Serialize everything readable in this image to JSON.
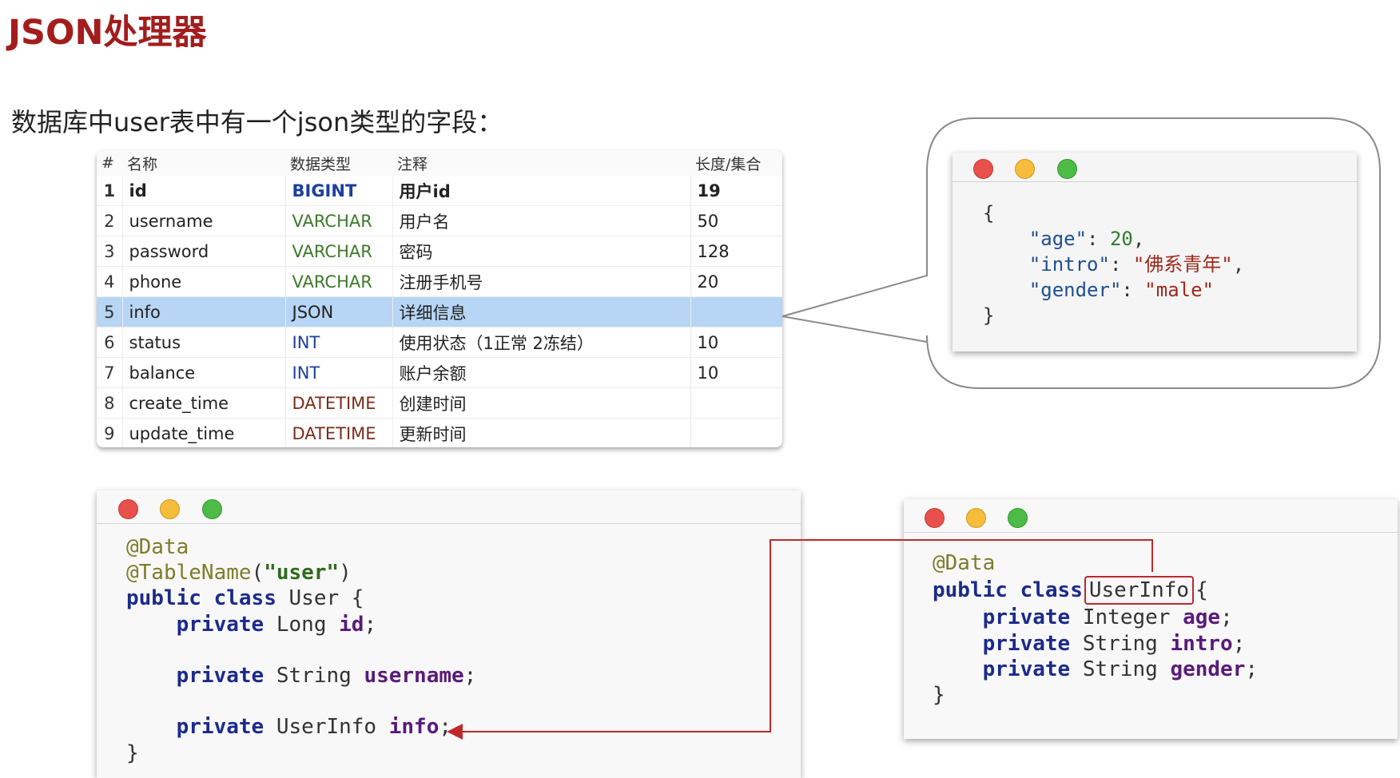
{
  "title": "JSON处理器",
  "subtitle": "数据库中user表中有一个json类型的字段：",
  "table": {
    "headers": [
      "#",
      "名称",
      "数据类型",
      "注释",
      "长度/集合"
    ],
    "rows": [
      {
        "num": "1",
        "name": "id",
        "type": "BIGINT",
        "comment": "用户id",
        "length": "19"
      },
      {
        "num": "2",
        "name": "username",
        "type": "VARCHAR",
        "comment": "用户名",
        "length": "50"
      },
      {
        "num": "3",
        "name": "password",
        "type": "VARCHAR",
        "comment": "密码",
        "length": "128"
      },
      {
        "num": "4",
        "name": "phone",
        "type": "VARCHAR",
        "comment": "注册手机号",
        "length": "20"
      },
      {
        "num": "5",
        "name": "info",
        "type": "JSON",
        "comment": "详细信息",
        "length": ""
      },
      {
        "num": "6",
        "name": "status",
        "type": "INT",
        "comment": "使用状态（1正常 2冻结）",
        "length": "10"
      },
      {
        "num": "7",
        "name": "balance",
        "type": "INT",
        "comment": "账户余额",
        "length": "10"
      },
      {
        "num": "8",
        "name": "create_time",
        "type": "DATETIME",
        "comment": "创建时间",
        "length": ""
      },
      {
        "num": "9",
        "name": "update_time",
        "type": "DATETIME",
        "comment": "更新时间",
        "length": ""
      }
    ]
  },
  "json_window": {
    "open": "{",
    "close": "}",
    "lines": [
      {
        "key": "\"age\"",
        "sep": ": ",
        "value": "20",
        "end": ","
      },
      {
        "key": "\"intro\"",
        "sep": ": ",
        "value": "\"佛系青年\"",
        "end": ","
      },
      {
        "key": "\"gender\"",
        "sep": ": ",
        "value": "\"male\"",
        "end": ""
      }
    ]
  },
  "user_class": {
    "annotation1": "@Data",
    "annotation2_name": "@TableName",
    "annotation2_arg": "\"user\"",
    "kw_public": "public",
    "kw_class": "class",
    "class_name": "User",
    "open_brace": "{",
    "close_brace": "}",
    "fields": [
      {
        "kw": "private",
        "type": "Long",
        "name": "id"
      },
      {
        "kw": "private",
        "type": "String",
        "name": "username"
      },
      {
        "kw": "private",
        "type": "UserInfo",
        "name": "info"
      }
    ]
  },
  "userinfo_class": {
    "annotation": "@Data",
    "kw_public": "public",
    "kw_class": "class",
    "class_name": "UserInfo",
    "open_brace": "{",
    "close_brace": "}",
    "fields": [
      {
        "kw": "private",
        "type": "Integer",
        "name": "age"
      },
      {
        "kw": "private",
        "type": "String",
        "name": "intro"
      },
      {
        "kw": "private",
        "type": "String",
        "name": "gender"
      }
    ]
  },
  "colors": {
    "title": "#a31d1d",
    "selected_row": "#b7d5f4",
    "highlight_box": "#c0282c",
    "keyword": "#1b2a8c",
    "field": "#5a1a7a",
    "annotation": "#7d7d2a"
  }
}
